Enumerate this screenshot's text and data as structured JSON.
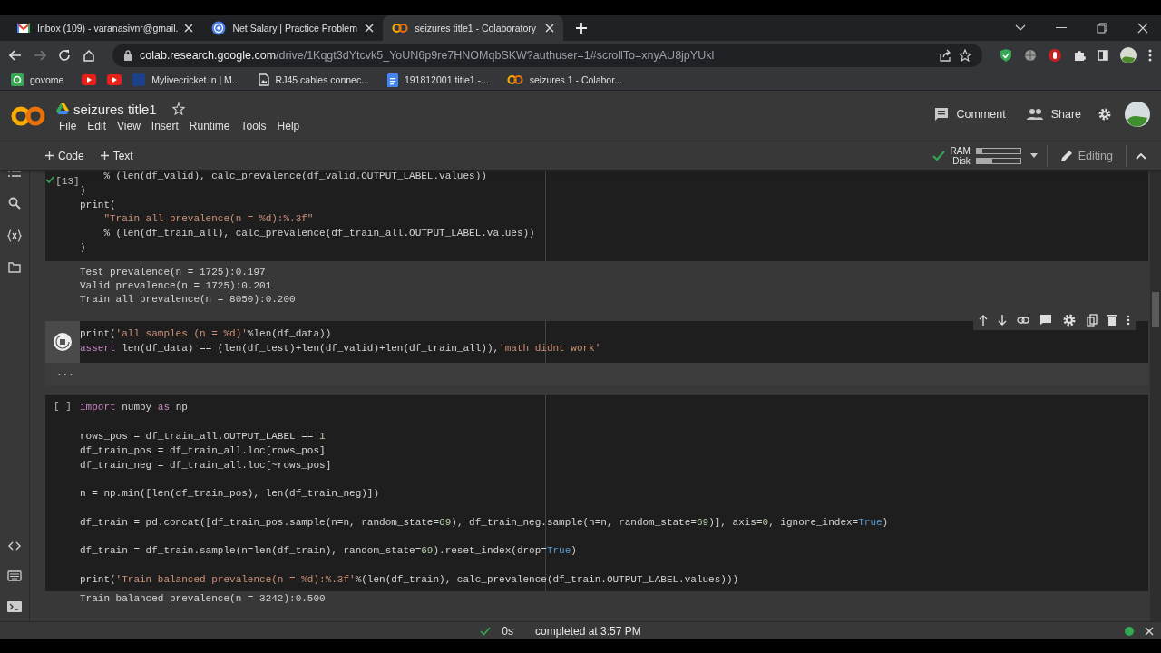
{
  "browser": {
    "tabs": [
      {
        "title": "Inbox (109) - varanasivnr@gmail.",
        "selected": false
      },
      {
        "title": "Net Salary | Practice Problem",
        "selected": false
      },
      {
        "title": "seizures title1 - Colaboratory",
        "selected": true
      }
    ],
    "address": {
      "host": "colab.research.google.com",
      "path": "/drive/1Kqgt3dYtcvk5_YoUN6p9re7HNOMqbSKW?authuser=1#scrollTo=xnyAU8jpYUkl"
    },
    "bookmarks": [
      {
        "label": "govome"
      },
      {
        "kind": "video"
      },
      {
        "kind": "video"
      },
      {
        "label": "Mylivecricket.in | M..."
      },
      {
        "label": "RJ45 cables connec..."
      },
      {
        "label": "191812001 title1 -..."
      },
      {
        "label": "seizures 1 - Colabor..."
      }
    ]
  },
  "notebook": {
    "title": "seizures title1",
    "starred": false,
    "menu": [
      "File",
      "Edit",
      "View",
      "Insert",
      "Runtime",
      "Tools",
      "Help"
    ],
    "actions": [
      "Comment",
      "Share"
    ],
    "toolbar": {
      "add": [
        "Code",
        "Text"
      ],
      "resources": [
        {
          "label": "RAM",
          "level": 0.12
        },
        {
          "label": "Disk",
          "level": 0.35
        }
      ],
      "mode": "Editing"
    }
  },
  "cells": [
    {
      "kind": "done",
      "count": "[13]",
      "lines": [
        [
          {
            "kind": "plain",
            "text": "    % (len(df_valid), calc_prevalence(df_valid.OUTPUT_LABEL.values))"
          }
        ],
        [
          {
            "kind": "plain",
            "text": ")"
          }
        ],
        [
          {
            "kind": "plain",
            "text": "print("
          }
        ],
        [
          {
            "kind": "str",
            "text": "    \"Train all prevalence(n = %d):%.3f\""
          }
        ],
        [
          {
            "kind": "plain",
            "text": "    % (len(df_train_all), calc_prevalence(df_train_all.OUTPUT_LABEL.values))"
          }
        ],
        [
          {
            "kind": "plain",
            "text": ")"
          }
        ]
      ],
      "output": [
        "Test prevalence(n = 1725):0.197",
        "Valid prevalence(n = 1725):0.201",
        "Train all prevalence(n = 8050):0.200"
      ]
    },
    {
      "kind": "running",
      "lines": [
        [
          {
            "kind": "plain",
            "text": "print("
          },
          {
            "kind": "str",
            "text": "'all samples (n = %d)'"
          },
          {
            "kind": "plain",
            "text": "%len(df_data))"
          }
        ],
        [
          {
            "kind": "kw",
            "text": "assert"
          },
          {
            "kind": "plain",
            "text": " len(df_data) == (len(df_test)+len(df_valid)+len(df_train_all)),"
          },
          {
            "kind": "str",
            "text": "'math didnt work'"
          }
        ]
      ],
      "output": [
        "..."
      ]
    },
    {
      "kind": "idle",
      "count": "[ ]",
      "blocks": [
        {
          "gap_before": false,
          "tokens": [
            {
              "kind": "kw",
              "text": "import"
            },
            {
              "kind": "plain",
              "text": " numpy "
            },
            {
              "kind": "kw",
              "text": "as"
            },
            {
              "kind": "plain",
              "text": " np"
            }
          ]
        },
        {
          "gap_before": true,
          "tokens": [
            {
              "kind": "plain",
              "text": "rows_pos = df_train_all.OUTPUT_LABEL == "
            },
            {
              "kind": "num",
              "text": "1"
            }
          ]
        },
        {
          "gap_before": false,
          "tokens": [
            {
              "kind": "plain",
              "text": "df_train_pos = df_train_all.loc[rows_pos]"
            }
          ]
        },
        {
          "gap_before": false,
          "tokens": [
            {
              "kind": "plain",
              "text": "df_train_neg = df_train_all.loc[~rows_pos]"
            }
          ]
        },
        {
          "gap_before": true,
          "tokens": [
            {
              "kind": "plain",
              "text": "n = np.min([len(df_train_pos), len(df_train_neg)])"
            }
          ]
        },
        {
          "gap_before": true,
          "tokens": [
            {
              "kind": "plain",
              "text": "df_train = pd.concat([df_train_pos.sample(n=n, random_state="
            },
            {
              "kind": "num",
              "text": "69"
            },
            {
              "kind": "plain",
              "text": "), df_train_neg.sample(n=n, random_state="
            },
            {
              "kind": "num",
              "text": "69"
            },
            {
              "kind": "plain",
              "text": ")], axis="
            },
            {
              "kind": "num",
              "text": "0"
            },
            {
              "kind": "plain",
              "text": ", ignore_index="
            },
            {
              "kind": "const",
              "text": "True"
            },
            {
              "kind": "plain",
              "text": ")"
            }
          ]
        },
        {
          "gap_before": true,
          "tokens": [
            {
              "kind": "plain",
              "text": "df_train = df_train.sample(n=len(df_train), random_state="
            },
            {
              "kind": "num",
              "text": "69"
            },
            {
              "kind": "plain",
              "text": ").reset_index(drop="
            },
            {
              "kind": "const",
              "text": "True"
            },
            {
              "kind": "plain",
              "text": ")"
            }
          ]
        },
        {
          "gap_before": true,
          "tokens": [
            {
              "kind": "plain",
              "text": "print("
            },
            {
              "kind": "str",
              "text": "'Train balanced prevalence(n = %d):%.3f'"
            },
            {
              "kind": "plain",
              "text": "%(len(df_train), calc_prevalence(df_train.OUTPUT_LABEL.values)))"
            }
          ]
        }
      ],
      "output": [
        "Train balanced prevalence(n = 3242):0.500"
      ]
    }
  ],
  "status": {
    "time": "0s",
    "message": "completed at 3:57 PM"
  }
}
